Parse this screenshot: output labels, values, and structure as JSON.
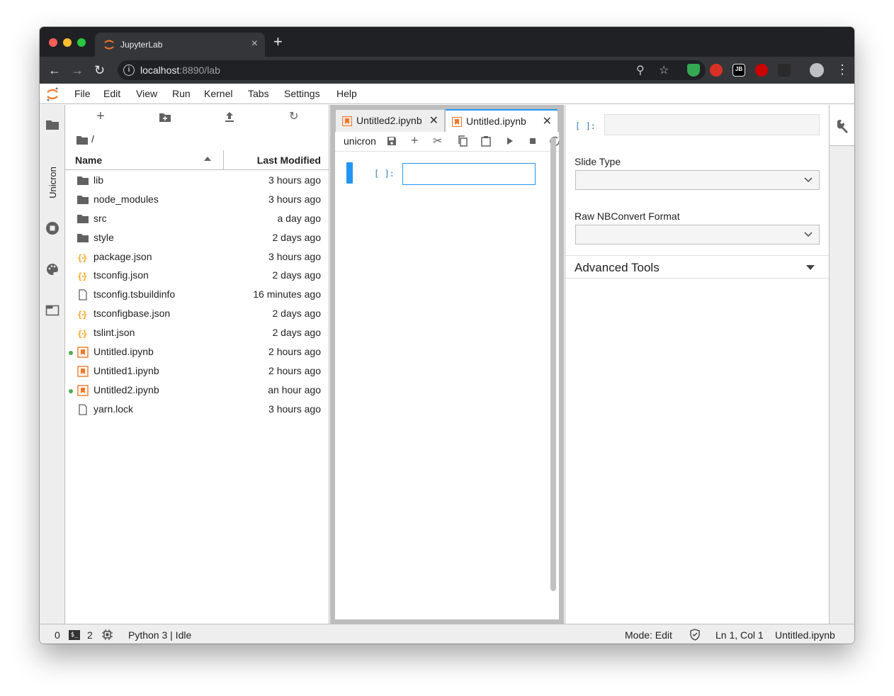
{
  "browser": {
    "tab_title": "JupyterLab",
    "url_host": "localhost",
    "url_rest": ":8890/lab"
  },
  "menu": [
    "File",
    "Edit",
    "View",
    "Run",
    "Kernel",
    "Tabs",
    "Settings",
    "Help"
  ],
  "left_sidebar": {
    "unicron_label": "Unicron"
  },
  "file_browser": {
    "breadcrumb": "/",
    "col_name": "Name",
    "col_modified": "Last Modified",
    "files": [
      {
        "name": "lib",
        "modified": "3 hours ago",
        "type": "folder",
        "running": false
      },
      {
        "name": "node_modules",
        "modified": "3 hours ago",
        "type": "folder",
        "running": false
      },
      {
        "name": "src",
        "modified": "a day ago",
        "type": "folder",
        "running": false
      },
      {
        "name": "style",
        "modified": "2 days ago",
        "type": "folder",
        "running": false
      },
      {
        "name": "package.json",
        "modified": "3 hours ago",
        "type": "json",
        "running": false
      },
      {
        "name": "tsconfig.json",
        "modified": "2 days ago",
        "type": "json",
        "running": false
      },
      {
        "name": "tsconfig.tsbuildinfo",
        "modified": "16 minutes ago",
        "type": "file",
        "running": false
      },
      {
        "name": "tsconfigbase.json",
        "modified": "2 days ago",
        "type": "json",
        "running": false
      },
      {
        "name": "tslint.json",
        "modified": "2 days ago",
        "type": "json",
        "running": false
      },
      {
        "name": "Untitled.ipynb",
        "modified": "2 hours ago",
        "type": "notebook",
        "running": true
      },
      {
        "name": "Untitled1.ipynb",
        "modified": "2 hours ago",
        "type": "notebook",
        "running": false
      },
      {
        "name": "Untitled2.ipynb",
        "modified": "an hour ago",
        "type": "notebook",
        "running": true
      },
      {
        "name": "yarn.lock",
        "modified": "3 hours ago",
        "type": "file",
        "running": false
      }
    ]
  },
  "notebook": {
    "tabs": [
      {
        "label": "Untitled2.ipynb",
        "active": false
      },
      {
        "label": "Untitled.ipynb",
        "active": true
      }
    ],
    "kernel_name": "unicron",
    "cell_prompt": "[ ]:"
  },
  "inspector": {
    "cell_prompt": "[ ]:",
    "slide_type_label": "Slide Type",
    "slide_type_value": "",
    "raw_format_label": "Raw NBConvert Format",
    "raw_format_value": "",
    "advanced_label": "Advanced Tools"
  },
  "statusbar": {
    "terminals": "0",
    "kernels": "2",
    "kernel_status": "Python 3 | Idle",
    "mode": "Mode: Edit",
    "cursor": "Ln 1, Col 1",
    "file": "Untitled.ipynb"
  },
  "colors": {
    "accent": "#2196f3",
    "jupyter_orange": "#f37726",
    "running_dot": "#4caf50"
  }
}
